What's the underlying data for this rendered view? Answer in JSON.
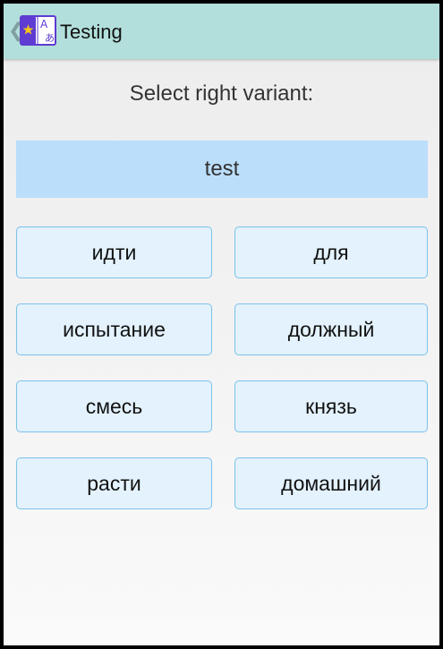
{
  "appbar": {
    "title": "Testing",
    "back_icon": "chevron-left-icon",
    "app_icon": "dictionary-book-icon",
    "app_icon_glyphs": [
      "A",
      "あ"
    ],
    "color": "#b2dfdb"
  },
  "prompt": "Select right variant:",
  "word": {
    "text": "test",
    "background": "#bbdefb"
  },
  "options": [
    "идти",
    "для",
    "испытание",
    "должный",
    "смесь",
    "князь",
    "расти",
    "домашний"
  ],
  "colors": {
    "option_bg": "#e3f2fd",
    "option_border": "#7cc1ea",
    "icon_purple": "#5e3bd1",
    "icon_star": "#f5c518"
  }
}
